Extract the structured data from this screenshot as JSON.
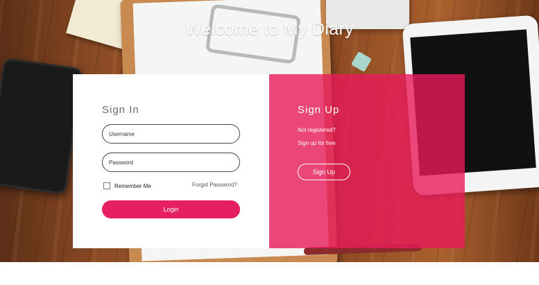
{
  "page": {
    "title": "Welcome to My Diary"
  },
  "signin": {
    "heading": "Sign In",
    "username_placeholder": "Username",
    "password_placeholder": "Password",
    "remember_label": "Remember Me",
    "forgot_label": "Forgot Password?",
    "login_label": "Login"
  },
  "signup": {
    "heading": "Sign Up",
    "line1": "Not registered?",
    "line2": "Sign up for free",
    "button_label": "Sign Up"
  },
  "colors": {
    "accent": "#e61e62",
    "panel_overlay": "#e81a5a"
  }
}
